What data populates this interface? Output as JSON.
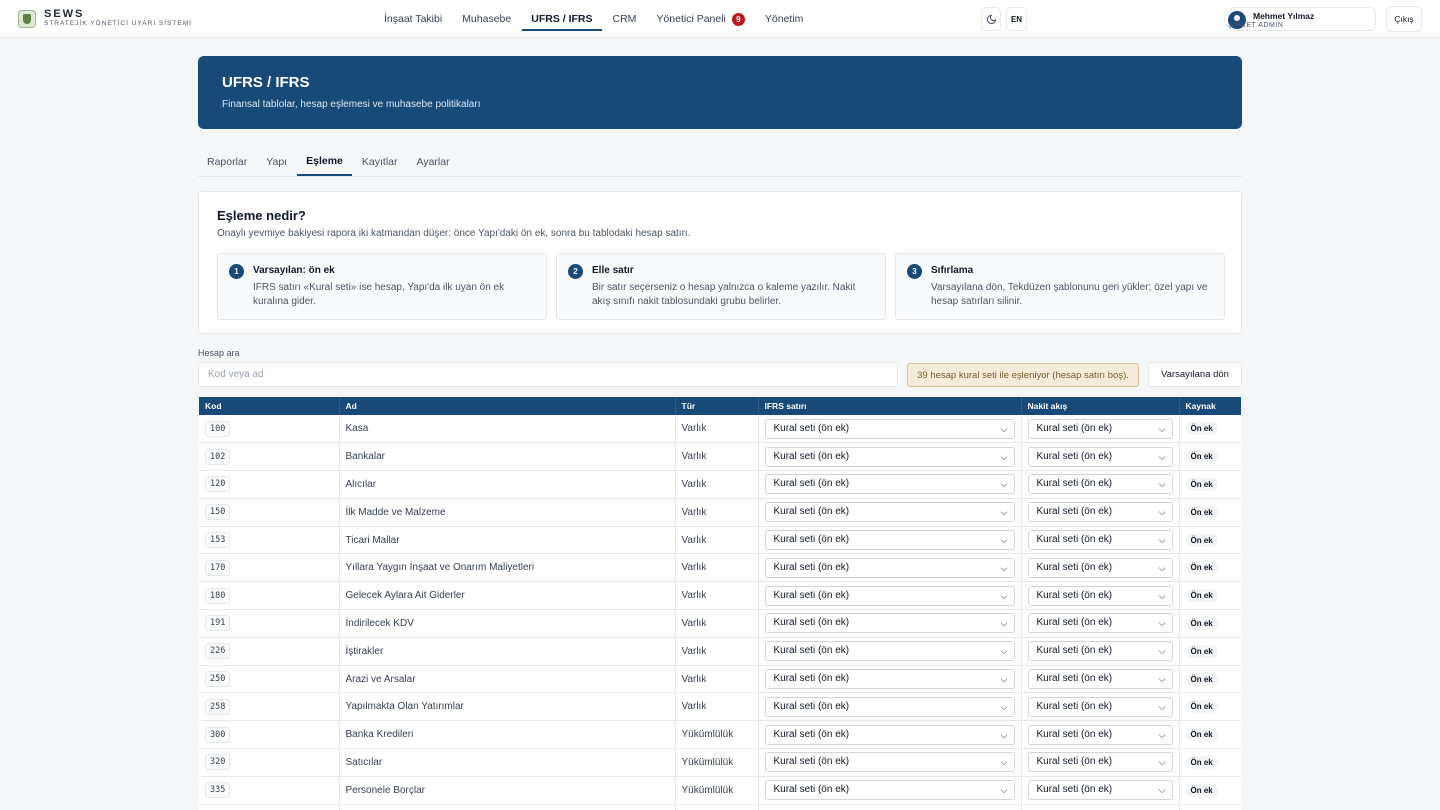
{
  "brand": {
    "name": "SEWS",
    "subtitle": "STRATEJİK YÖNETİCİ UYARI SİSTEMİ"
  },
  "nav": {
    "items": [
      {
        "label": "İnşaat Takibi"
      },
      {
        "label": "Muhasebe"
      },
      {
        "label": "UFRS / IFRS",
        "active": true
      },
      {
        "label": "CRM"
      },
      {
        "label": "Yönetici Paneli",
        "badge": "9"
      },
      {
        "label": "Yönetim"
      }
    ]
  },
  "toolbar": {
    "theme_icon": "moon-icon",
    "lang_label": "EN",
    "logout_label": "Çıkış"
  },
  "user": {
    "name": "Mehmet Yılmaz",
    "role": "ŞİRKET ADMİN"
  },
  "hero": {
    "title": "UFRS / IFRS",
    "subtitle": "Finansal tablolar, hesap eşlemesi ve muhasebe politikaları"
  },
  "tabs": [
    "Raporlar",
    "Yapı",
    "Eşleme",
    "Kayıtlar",
    "Ayarlar"
  ],
  "active_tab": "Eşleme",
  "info": {
    "title": "Eşleme nedir?",
    "subtitle": "Onaylı yevmiye bakiyesi rapora iki katmandan düşer: önce Yapı'daki ön ek, sonra bu tablodaki hesap satırı.",
    "steps": [
      {
        "num": "1",
        "title": "Varsayılan: ön ek",
        "text": "IFRS satırı «Kural seti» ise hesap, Yapı'da ilk uyan ön ek kuralına gider."
      },
      {
        "num": "2",
        "title": "Elle satır",
        "text": "Bir satır seçerseniz o hesap yalnızca o kaleme yazılır. Nakit akış sınıfı nakit tablosundaki grubu belirler."
      },
      {
        "num": "3",
        "title": "Sıfırlama",
        "text": "Varsayılana dön, Tekdüzen şablonunu geri yükler; özel yapı ve hesap satırları silinir."
      }
    ]
  },
  "search": {
    "label": "Hesap ara",
    "placeholder": "Kod veya ad",
    "value": ""
  },
  "notice": "39 hesap kural seti ile eşleniyor (hesap satırı boş).",
  "reset_label": "Varsayılana dön",
  "table": {
    "headers": [
      "Kod",
      "Ad",
      "Tür",
      "IFRS satırı",
      "Nakit akış",
      "Kaynak"
    ],
    "rows": [
      {
        "code": "100",
        "name": "Kasa",
        "type": "Varlık",
        "ifrs": "Kural seti (ön ek)",
        "cash": "Kural seti (ön ek)",
        "source": "Ön ek"
      },
      {
        "code": "102",
        "name": "Bankalar",
        "type": "Varlık",
        "ifrs": "Kural seti (ön ek)",
        "cash": "Kural seti (ön ek)",
        "source": "Ön ek"
      },
      {
        "code": "120",
        "name": "Alıcılar",
        "type": "Varlık",
        "ifrs": "Kural seti (ön ek)",
        "cash": "Kural seti (ön ek)",
        "source": "Ön ek"
      },
      {
        "code": "150",
        "name": "İlk Madde ve Malzeme",
        "type": "Varlık",
        "ifrs": "Kural seti (ön ek)",
        "cash": "Kural seti (ön ek)",
        "source": "Ön ek"
      },
      {
        "code": "153",
        "name": "Ticari Mallar",
        "type": "Varlık",
        "ifrs": "Kural seti (ön ek)",
        "cash": "Kural seti (ön ek)",
        "source": "Ön ek"
      },
      {
        "code": "170",
        "name": "Yıllara Yaygın İnşaat ve Onarım Maliyetleri",
        "type": "Varlık",
        "ifrs": "Kural seti (ön ek)",
        "cash": "Kural seti (ön ek)",
        "source": "Ön ek"
      },
      {
        "code": "180",
        "name": "Gelecek Aylara Ait Giderler",
        "type": "Varlık",
        "ifrs": "Kural seti (ön ek)",
        "cash": "Kural seti (ön ek)",
        "source": "Ön ek"
      },
      {
        "code": "191",
        "name": "İndirilecek KDV",
        "type": "Varlık",
        "ifrs": "Kural seti (ön ek)",
        "cash": "Kural seti (ön ek)",
        "source": "Ön ek"
      },
      {
        "code": "226",
        "name": "İştirakler",
        "type": "Varlık",
        "ifrs": "Kural seti (ön ek)",
        "cash": "Kural seti (ön ek)",
        "source": "Ön ek"
      },
      {
        "code": "250",
        "name": "Arazi ve Arsalar",
        "type": "Varlık",
        "ifrs": "Kural seti (ön ek)",
        "cash": "Kural seti (ön ek)",
        "source": "Ön ek"
      },
      {
        "code": "258",
        "name": "Yapılmakta Olan Yatırımlar",
        "type": "Varlık",
        "ifrs": "Kural seti (ön ek)",
        "cash": "Kural seti (ön ek)",
        "source": "Ön ek"
      },
      {
        "code": "300",
        "name": "Banka Kredileri",
        "type": "Yükümlülük",
        "ifrs": "Kural seti (ön ek)",
        "cash": "Kural seti (ön ek)",
        "source": "Ön ek"
      },
      {
        "code": "320",
        "name": "Satıcılar",
        "type": "Yükümlülük",
        "ifrs": "Kural seti (ön ek)",
        "cash": "Kural seti (ön ek)",
        "source": "Ön ek"
      },
      {
        "code": "335",
        "name": "Personele Borçlar",
        "type": "Yükümlülük",
        "ifrs": "Kural seti (ön ek)",
        "cash": "Kural seti (ön ek)",
        "source": "Ön ek"
      },
      {
        "code": "",
        "name": "",
        "type": "",
        "ifrs": "",
        "cash": "",
        "source": ""
      }
    ]
  }
}
